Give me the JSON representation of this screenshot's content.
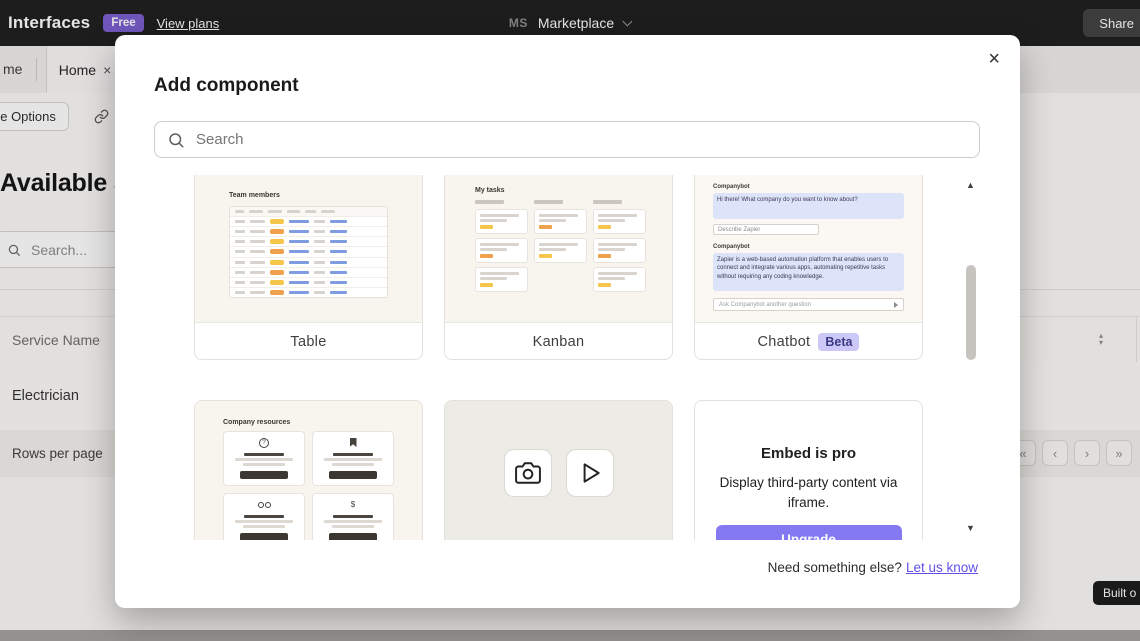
{
  "topbar": {
    "app_title": "Interfaces",
    "plan_badge": "Free",
    "view_plans_label": "View plans",
    "workspace_initials": "MS",
    "workspace_name": "Marketplace",
    "share_label": "Share"
  },
  "tabs": {
    "left_tab_partial": "me",
    "active_tab_label": "Home",
    "close_glyph": "×"
  },
  "toolbar": {
    "page_options_partial": "ge Options"
  },
  "page": {
    "heading_partial": "Available S",
    "search_placeholder": "Search...",
    "column_header": "Service Name",
    "sort_up_glyph": "▴",
    "sort_down_glyph": "▾",
    "row_1": "Electrician",
    "rows_per_page_label": "Rows per page",
    "pagination": {
      "first": "«",
      "prev": "‹",
      "next": "›",
      "last": "»"
    },
    "built_badge_partial": "Built o"
  },
  "modal": {
    "title": "Add component",
    "close_glyph": "×",
    "search_placeholder": "Search",
    "scroll_up_glyph": "▲",
    "scroll_down_glyph": "▼",
    "footer_prompt": "Need something else?",
    "footer_link": "Let us know",
    "cards": {
      "table": {
        "label": "Table",
        "thumb_title": "Team members"
      },
      "kanban": {
        "label": "Kanban",
        "thumb_title": "My tasks"
      },
      "chatbot": {
        "label": "Chatbot",
        "badge": "Beta",
        "bot_name": "Companybot",
        "greeting": "Hi there! What company do you want to know about?",
        "input_value": "Describe Zapier",
        "answer": "Zapier is a web-based automation platform that enables users to connect and integrate various apps, automating repetitive tasks without requiring any coding knowledge.",
        "ask_placeholder": "Ask Companybot another question"
      },
      "links": {
        "thumb_title": "Company resources"
      },
      "embed": {
        "title": "Embed is pro",
        "description": "Display third-party content via iframe.",
        "button_label": "Upgrade"
      }
    }
  },
  "colors": {
    "accent_purple": "#8579f2",
    "beta_badge_bg": "#cbc8f7",
    "link_purple": "#5f51e6",
    "pill_yellow": "#f5c64a",
    "pill_orange": "#f0a14b"
  }
}
